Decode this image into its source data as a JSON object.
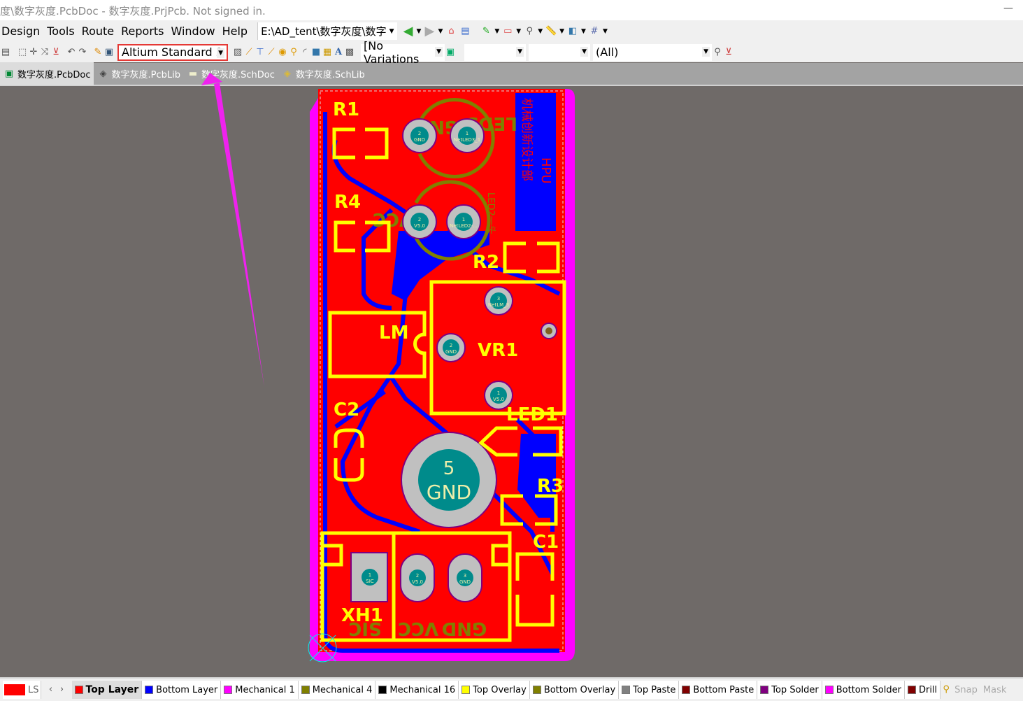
{
  "window": {
    "title": "度\\数字灰度.PcbDoc - 数字灰度.PrjPcb. Not signed in.",
    "minimize": "—"
  },
  "menu": {
    "items": [
      "Design",
      "Tools",
      "Route",
      "Reports",
      "Window",
      "Help"
    ],
    "path": "E:\\AD_tent\\数字灰度\\数字"
  },
  "toolbar": {
    "standard_combo": "Altium Standard 2",
    "variations_combo": "[No Variations",
    "combo2": "",
    "combo3": "",
    "filter_combo": "(All)"
  },
  "tabs": [
    {
      "label": "数字灰度.PcbDoc",
      "active": true
    },
    {
      "label": "数字灰度.PcbLib"
    },
    {
      "label": "数字灰度.SchDoc"
    },
    {
      "label": "数字灰度.SchLib"
    }
  ],
  "pcb": {
    "designators": [
      "R1",
      "R4",
      "R2",
      "LM",
      "VR1",
      "C2",
      "LED1",
      "R3",
      "C1",
      "XH1"
    ],
    "bottom_overlay": [
      "GND",
      "LED3",
      "VCC",
      "LED2一头",
      "SIC",
      "VCC",
      "GND"
    ],
    "bottom_text": [
      "HPU",
      "机械创新设计部"
    ],
    "pads": [
      {
        "num": "2",
        "net": "GND"
      },
      {
        "num": "1",
        "net": "NetLED3_1"
      },
      {
        "num": "2",
        "net": "V5.0"
      },
      {
        "num": "1",
        "net": "NetLED2-..."
      },
      {
        "num": "3",
        "net": "NetLM_3"
      },
      {
        "num": "2",
        "net": "GND"
      },
      {
        "num": "1",
        "net": "V5.0"
      },
      {
        "num": "5",
        "net": "GND"
      },
      {
        "num": "1",
        "net": "SIC"
      },
      {
        "num": "2",
        "net": "V5.0"
      },
      {
        "num": "3",
        "net": "GND"
      }
    ],
    "colors": {
      "top_layer": "#ff0000",
      "bottom_layer": "#0000ff",
      "overlay": "#ffff00",
      "bottom_overlay": "#808000",
      "mechanical": "#ff00ff",
      "pad": "#c0c0c0",
      "pad_label": "#008b8b",
      "annotation_arrow": "#ee22ee"
    }
  },
  "status": {
    "current": "LS",
    "layers": [
      {
        "name": "Top Layer",
        "color": "#ff0000",
        "active": true
      },
      {
        "name": "Bottom Layer",
        "color": "#0000ff"
      },
      {
        "name": "Mechanical 1",
        "color": "#ff00ff"
      },
      {
        "name": "Mechanical 4",
        "color": "#808000"
      },
      {
        "name": "Mechanical 16",
        "color": "#000000"
      },
      {
        "name": "Top Overlay",
        "color": "#ffff00"
      },
      {
        "name": "Bottom Overlay",
        "color": "#808000"
      },
      {
        "name": "Top Paste",
        "color": "#808080"
      },
      {
        "name": "Bottom Paste",
        "color": "#800000"
      },
      {
        "name": "Top Solder",
        "color": "#800080"
      },
      {
        "name": "Bottom Solder",
        "color": "#ff00ff"
      },
      {
        "name": "Drill",
        "color": "#800000"
      }
    ],
    "snap": "Snap",
    "mask": "Mask"
  }
}
